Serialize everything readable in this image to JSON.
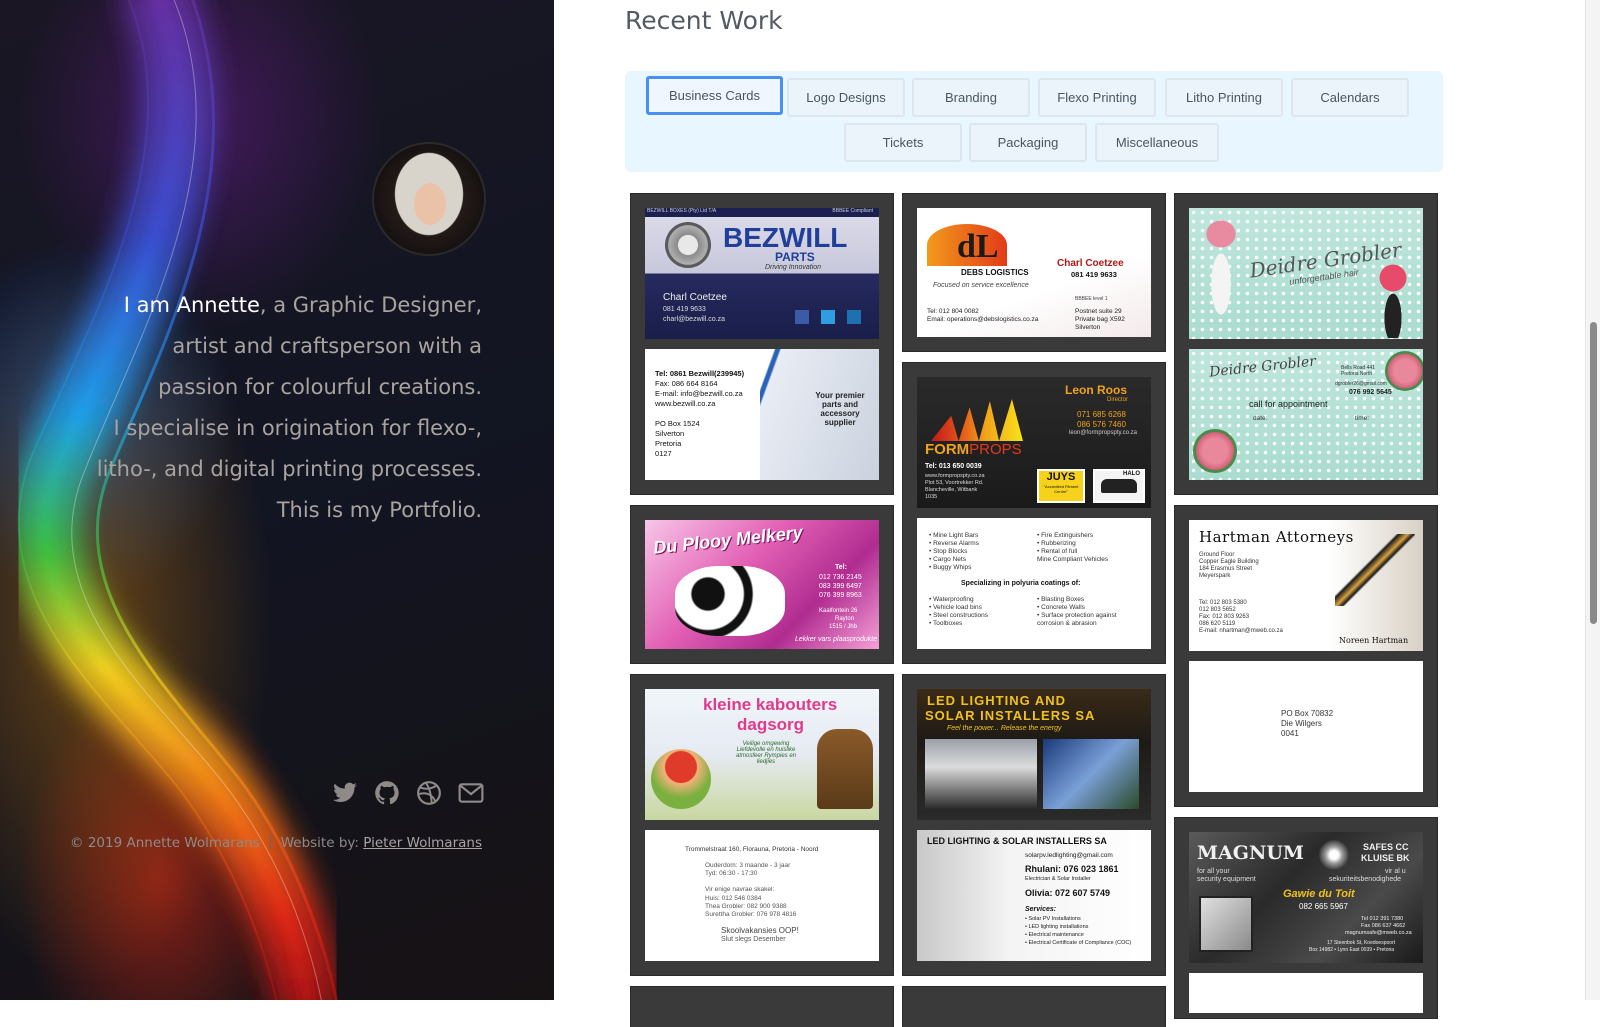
{
  "profile": {
    "greeting": "I am Annette",
    "bio_1": ", a Graphic Designer,",
    "bio_2": "artist and craftsperson with a",
    "bio_3": "passion for colourful creations.",
    "bio_4": "I specialise in origination for flexo-,",
    "bio_5": "litho-, and digital printing processes.",
    "bio_6": "This is my Portfolio."
  },
  "social": [
    "twitter-icon",
    "github-icon",
    "dribbble-icon",
    "mail-icon"
  ],
  "footer": {
    "copyright": "© 2019 Annette Wolmarans",
    "website_by": "Website by: ",
    "author_link": "Pieter Wolmarans"
  },
  "main": {
    "heading": "Recent Work",
    "filters": [
      "Business Cards",
      "Logo Designs",
      "Branding",
      "Flexo Printing",
      "Litho Printing",
      "Calendars",
      "Tickets",
      "Packaging",
      "Miscellaneous"
    ],
    "active_filter": "Business Cards"
  },
  "cards": {
    "bezwill": {
      "brand": "BEZWILL",
      "sub": "PARTS",
      "tag": "Driving Innovation",
      "header_left": "BEZWILL BOXES (Pty) Ltd T/A",
      "header_right": "BBBEE Compliant",
      "name": "Charl Coetzee",
      "phone": "081 419 9633",
      "email": "charl@bezwill.co.za",
      "back_tel": "Tel: 0861 Bezwill(239945)",
      "back_fax": "Fax: 086 664 8164",
      "back_email": "E-mail: info@bezwill.co.za",
      "back_web": "www.bezwill.co.za",
      "back_box": "PO Box 1524",
      "back_city": "Silverton",
      "back_town": "Pretoria",
      "back_code": "0127",
      "slogan": "Your premier parts and accessory supplier"
    },
    "debs": {
      "brand": "DEBS LOGISTICS",
      "tag": "Focused on service excellence",
      "name": "Charl Coetzee",
      "phone": "081 419 9633",
      "tel": "Tel: 012 804 0082",
      "email": "Email: operations@debslogistics.co.za",
      "level": "BBBEE level 1",
      "addr1": "Postnet suite 29",
      "addr2": "Private bag X592",
      "addr3": "Silverton"
    },
    "deidre": {
      "name": "Deidre Grobler",
      "tag": "unforgettable hair",
      "addr": "Bells Road 441",
      "city": "Pretoria North",
      "email": "dgrobler26@gmail.com",
      "phone": "076 992 5645",
      "call": "call for appointment",
      "date": "date:",
      "time": "time:"
    },
    "formprops": {
      "name": "Leon Roos",
      "title": "Director",
      "p1": "071 685 6268",
      "p2": "086 576 7460",
      "email": "leon@formpropspty.co.za",
      "brand_form": "FORM",
      "brand_props": "PROPS",
      "tel": "Tel:  013 650 0039",
      "web": "www.formpropspty.co.za",
      "addr1": "Plot 53, Voortrekker Rd.",
      "addr2": "Blancheville, Witbank",
      "code": "1035",
      "juys": "JUYS",
      "accred": "\"Accredited Fitment Centre\"",
      "halo": "HALO",
      "l1": "• Mine Light Bars",
      "l2": "• Reverse Alarms",
      "l3": "• Stop Blocks",
      "l4": "• Cargo Nets",
      "l5": "• Buggy Whips",
      "r1": "• Fire Extinguishers",
      "r2": "• Rubberizing",
      "r3": "• Rental of full",
      "r4": "  Mine Compliant Vehicles",
      "spec": "Specializing in polyuria coatings of:",
      "s1": "• Waterproofing",
      "s2": "• Vehicle load bins",
      "s3": "• Steel constructions",
      "s4": "• Toolboxes",
      "s5": "• Blasting Boxes",
      "s6": "• Concrete Walls",
      "s7": "• Surface protection against",
      "s8": "  corrosion & abrasion"
    },
    "duplooy": {
      "name": "Du Plooy Melkery",
      "tel": "Tel:",
      "p1": "012 736 2145",
      "p2": "083 399 6497",
      "p3": "076 399 8963",
      "addr": "Kaalfontein 26",
      "town": "Rayton",
      "code": "1515 / Jhb",
      "tag": "Lekker vars plaasprodukte"
    },
    "hartman": {
      "name": "Hartman Attorneys",
      "addr1": "Ground Floor",
      "addr2": "Copper Eagle Building",
      "addr3": "184 Erasmus Street",
      "addr4": "Meyerspark",
      "tel": "Tel:    012 803 5380",
      "tel2": "           012 803 5652",
      "fax": "Fax:    012 803 9263",
      "cell": "           086 620 5119",
      "email": "E-mail:  nhartman@mweb.co.za",
      "person": "Noreen Hartman",
      "box": "PO Box 70832",
      "area": "Die Wilgers",
      "code": "0041"
    },
    "kabouters": {
      "name1": "kleine kabouters",
      "name2": "dagsorg",
      "tag": "Veilige omgewing Liefdevolle en huislike atmosfeer Rympies en liedjies",
      "addr": "Trommelstraat 160, Florauna, Pretoria - Noord",
      "l1": "Ouderdom:   3 maande - 3 jaar",
      "l2": "Tyd:              06:30 - 17:30",
      "l3": "Vir enige navrae skakel:",
      "l4": "Huis:             012 546 0384",
      "l5": "Thea Grobler:  082 900 9388",
      "l6": "Surettha Grobler: 076 978 4816",
      "l7": "Skoolvakansies OOP!",
      "l8": "Slut slegs Desember"
    },
    "led": {
      "title1": "LED LIGHTING AND",
      "title2": "SOLAR INSTALLERS SA",
      "tag": "Feel the power...   Release the energy",
      "back_title": "LED LIGHTING & SOLAR INSTALLERS SA",
      "email": "solarpv.ledlighting@gmail.com",
      "name1": "Rhulani: 076 023 1861",
      "role": "Electrician & Solar Installer",
      "name2": "Olivia:  072 607 5749",
      "services": "Services:",
      "s1": "• Solar PV Installations",
      "s2": "• LED lighting installations",
      "s3": "• Electrical maintenance",
      "s4": "• Electrical Certificate of Compliance (COC)"
    },
    "magnum": {
      "brand": "MAGNUM",
      "right1": "SAFES CC",
      "right2": "KLUISE BK",
      "tag1": "for all your",
      "tag2": "security equipment",
      "tagr1": "vir al u",
      "tagr2": "sekuriteitsbenodighede",
      "name": "Gawie du Toit",
      "phone": "082 665 5967",
      "tel": "Tel 012 391 7380",
      "fax": "Fax 086 637 4662",
      "email": "magnumsafe@mweb.co.za",
      "addr": "17 Steenbok St, Koedoespoort",
      "box": "Box 14982 • Lynn East 0039 • Pretoria"
    }
  }
}
